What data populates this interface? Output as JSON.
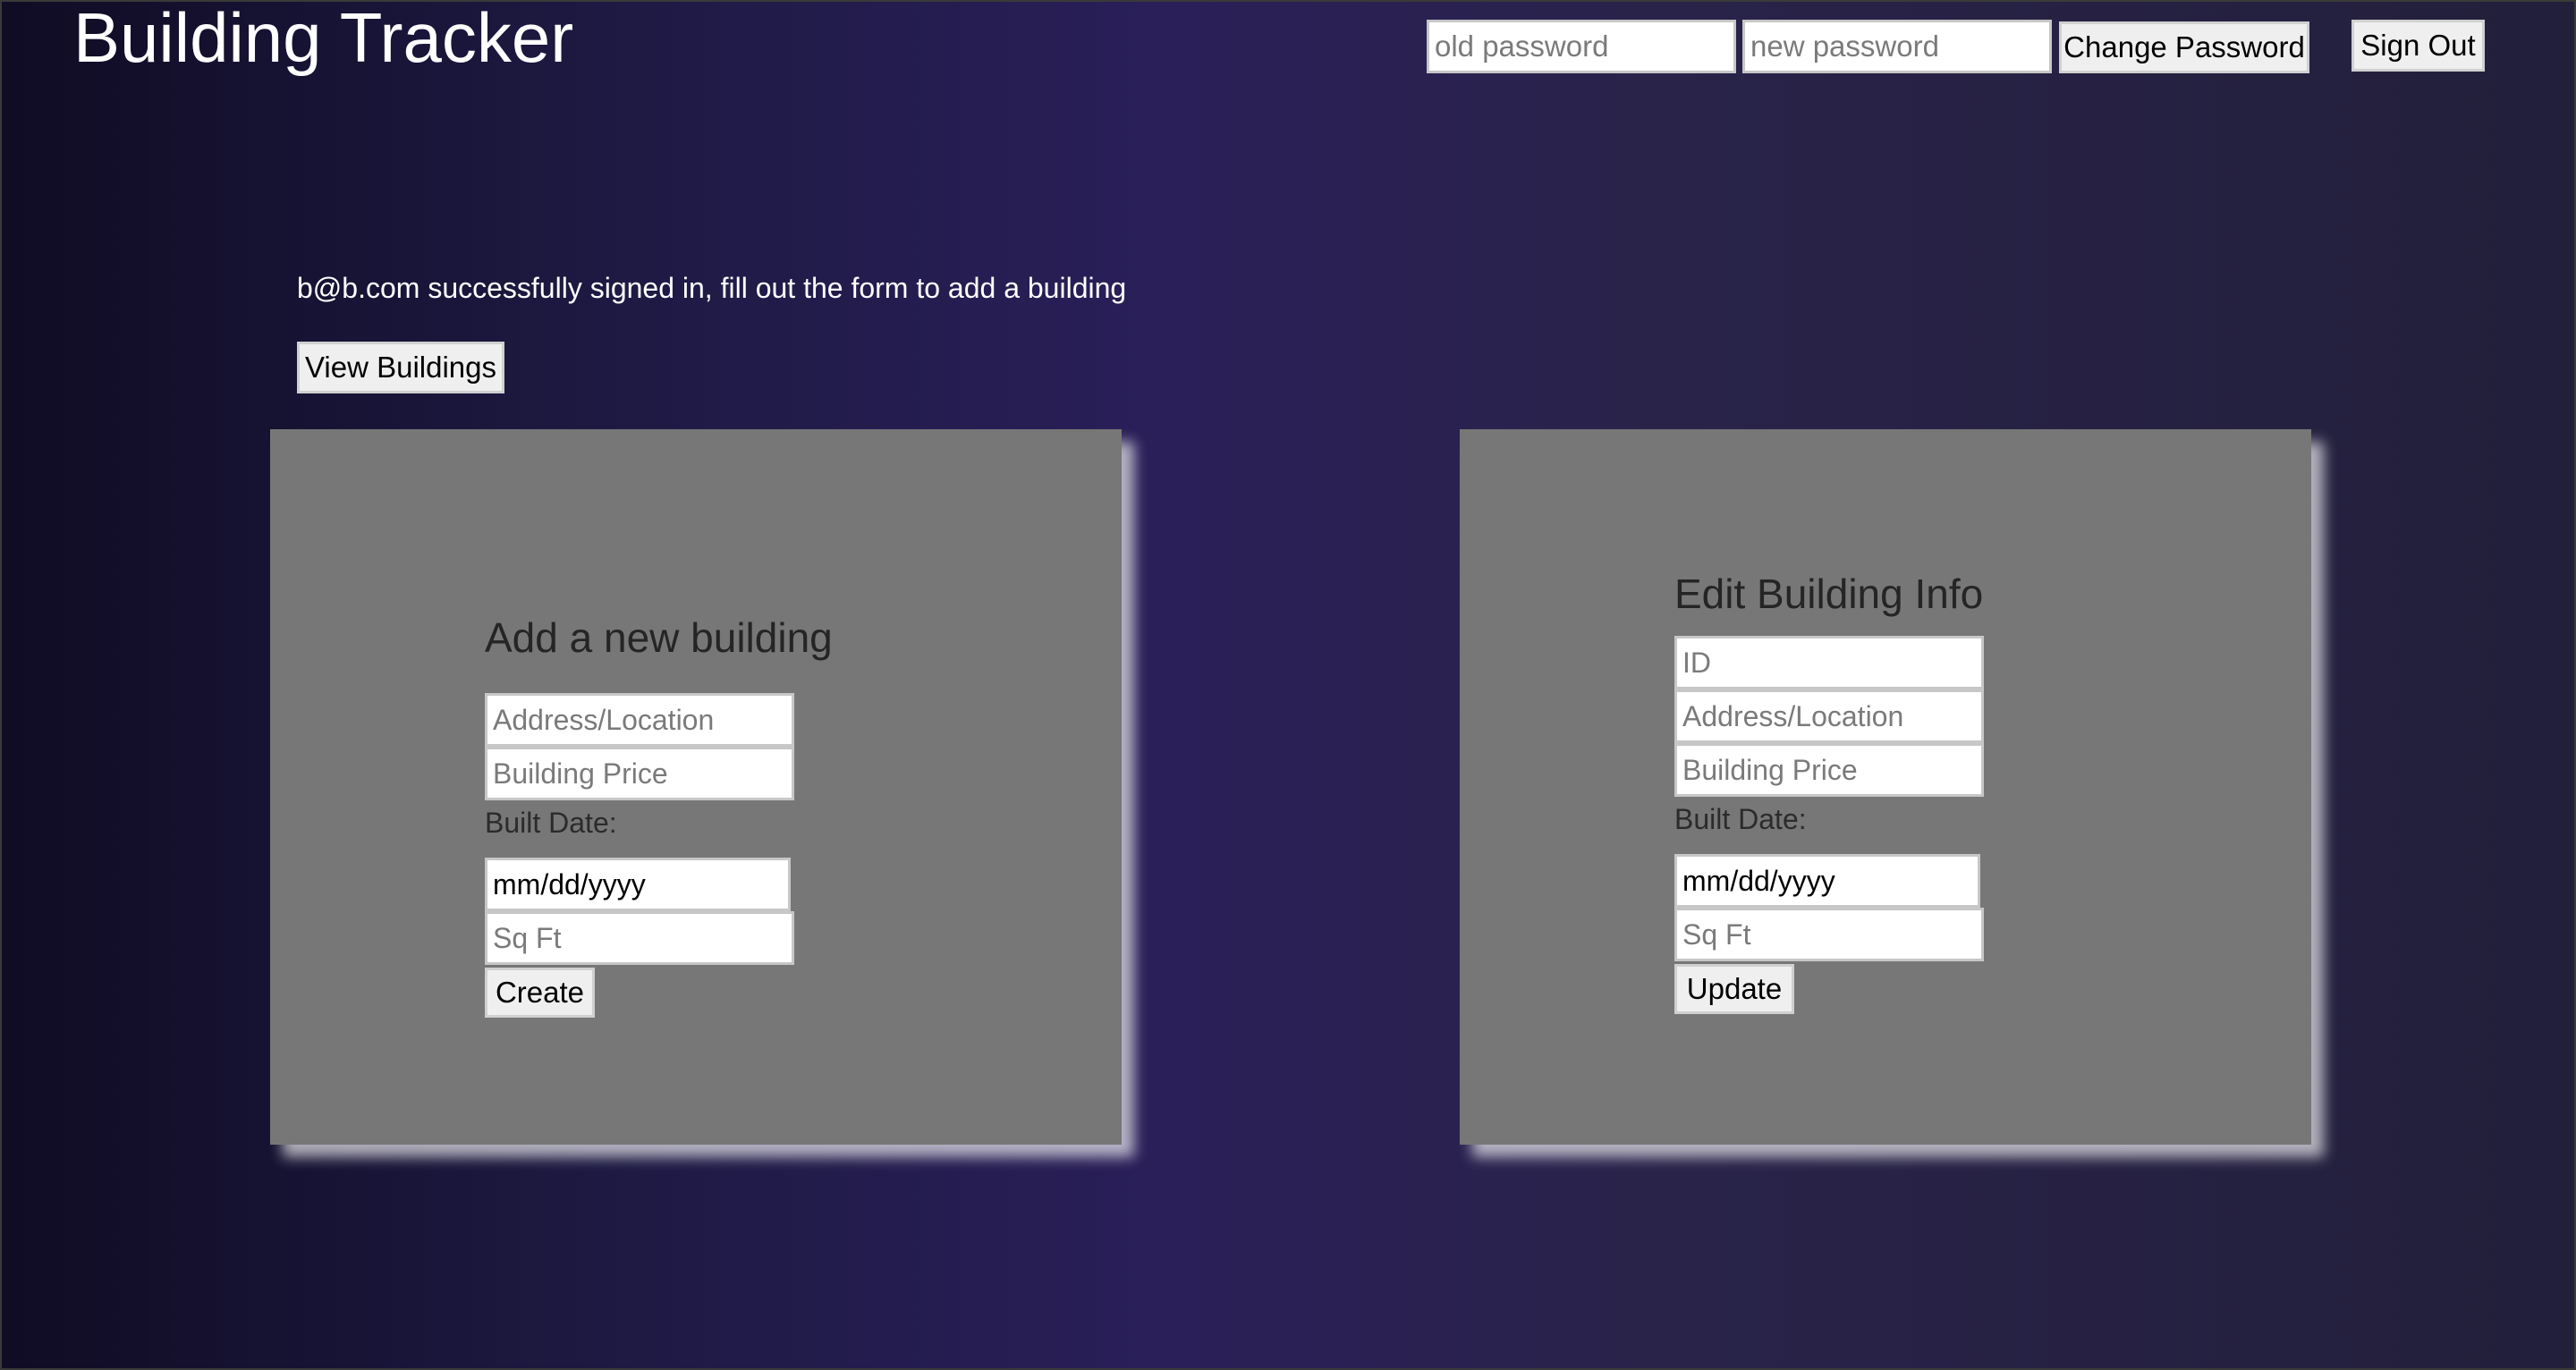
{
  "header": {
    "title": "Building Tracker",
    "old_password_placeholder": "old password",
    "new_password_placeholder": "new password",
    "change_password_label": "Change Password",
    "sign_out_label": "Sign Out"
  },
  "main": {
    "status_message": "b@b.com successfully signed in, fill out the form to add a building",
    "view_buildings_label": "View Buildings"
  },
  "add_form": {
    "heading": "Add a new building",
    "address_placeholder": "Address/Location",
    "price_placeholder": "Building Price",
    "built_date_label": "Built Date:",
    "date_value": "mm/dd/yyyy",
    "sqft_placeholder": "Sq Ft",
    "submit_label": "Create"
  },
  "edit_form": {
    "heading": "Edit Building Info",
    "id_placeholder": "ID",
    "address_placeholder": "Address/Location",
    "price_placeholder": "Building Price",
    "built_date_label": "Built Date:",
    "date_value": "mm/dd/yyyy",
    "sqft_placeholder": "Sq Ft",
    "submit_label": "Update"
  }
}
